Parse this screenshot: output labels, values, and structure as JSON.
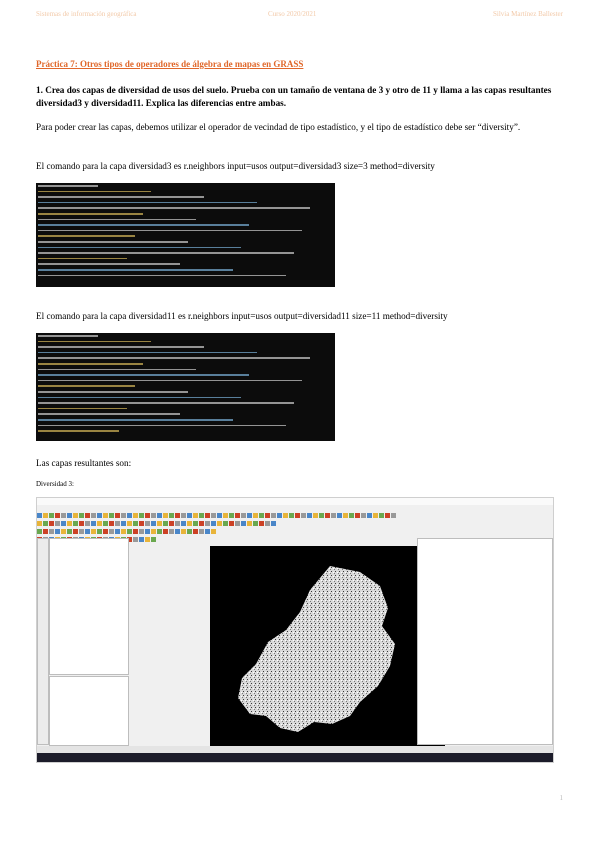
{
  "header": {
    "left": "Sistemas de información geográfica",
    "center": "Curso 2020/2021",
    "right": "Silvia Martínez Ballester"
  },
  "title": "Práctica 7: Otros tipos de operadores de álgebra de mapas en GRASS",
  "question": "1. Crea dos capas de diversidad de usos del suelo. Prueba con un tamaño de ventana de 3 y otro de 11 y llama a las capas resultantes diversidad3 y diversidad11. Explica las diferencias entre ambas.",
  "para1": "Para poder crear las capas, debemos utilizar el operador de vecindad de tipo estadístico, y el tipo de estadístico debe ser “diversity”.",
  "para2": "El comando para la capa diversidad3 es r.neighbors input=usos output=diversidad3 size=3 method=diversity",
  "para3": "El comando para la capa diversidad11 es r.neighbors input=usos output=diversidad11 size=11 method=diversity",
  "para4": "Las capas resultantes son:",
  "subtitle": "Diversidad 3:",
  "page_number": "1",
  "colors": {
    "accent": "#e0672a",
    "header": "#f2c9a8",
    "terminal": "#0c0c0c"
  }
}
